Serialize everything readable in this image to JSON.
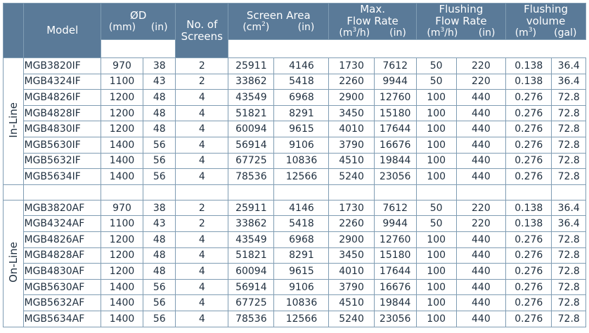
{
  "headers": {
    "model": "Model",
    "od": "ØD",
    "od_mm": "(mm)",
    "od_in": "(in)",
    "screens_1": "No. of",
    "screens_2": "Screens",
    "area": "Screen Area",
    "area_cm": "(cm",
    "area_cm_sup": "2",
    "area_cm_close": ")",
    "area_in": "(in)",
    "flow_1": "Max.",
    "flow_2": "Flow Rate",
    "flow_m": "(m",
    "flow_m_sup": "3",
    "flow_m_close": "/h)",
    "flow_in": "(in)",
    "flush_1": "Flushing",
    "flush_2": "Flow Rate",
    "flush_m": "(m",
    "flush_m_sup": "3",
    "flush_m_close": "/h)",
    "flush_in": "(in)",
    "vol_1": "Flushing",
    "vol_2": "volume",
    "vol_m": "(m",
    "vol_m_sup": "3",
    "vol_m_close": ")",
    "vol_gal": "(gal)"
  },
  "groups": [
    {
      "label": "In-Line",
      "rows": [
        [
          "MGB3820IF",
          "970",
          "38",
          "2",
          "25911",
          "4146",
          "1730",
          "7612",
          "50",
          "220",
          "0.138",
          "36.4"
        ],
        [
          "MGB4324IF",
          "1100",
          "43",
          "2",
          "33862",
          "5418",
          "2260",
          "9944",
          "50",
          "220",
          "0.138",
          "36.4"
        ],
        [
          "MGB4826IF",
          "1200",
          "48",
          "4",
          "43549",
          "6968",
          "2900",
          "12760",
          "100",
          "440",
          "0.276",
          "72.8"
        ],
        [
          "MGB4828IF",
          "1200",
          "48",
          "4",
          "51821",
          "8291",
          "3450",
          "15180",
          "100",
          "440",
          "0.276",
          "72.8"
        ],
        [
          "MGB4830IF",
          "1200",
          "48",
          "4",
          "60094",
          "9615",
          "4010",
          "17644",
          "100",
          "440",
          "0.276",
          "72.8"
        ],
        [
          "MGB5630IF",
          "1400",
          "56",
          "4",
          "56914",
          "9106",
          "3790",
          "16676",
          "100",
          "440",
          "0.276",
          "72.8"
        ],
        [
          "MGB5632IF",
          "1400",
          "56",
          "4",
          "67725",
          "10836",
          "4510",
          "19844",
          "100",
          "440",
          "0.276",
          "72.8"
        ],
        [
          "MGB5634IF",
          "1400",
          "56",
          "4",
          "78536",
          "12566",
          "5240",
          "23056",
          "100",
          "440",
          "0.276",
          "72.8"
        ]
      ]
    },
    {
      "label": "On-Line",
      "rows": [
        [
          "MGB3820AF",
          "970",
          "38",
          "2",
          "25911",
          "4146",
          "1730",
          "7612",
          "50",
          "220",
          "0.138",
          "36.4"
        ],
        [
          "MGB4324AF",
          "1100",
          "43",
          "2",
          "33862",
          "5418",
          "2260",
          "9944",
          "50",
          "220",
          "0.138",
          "36.4"
        ],
        [
          "MGB4826AF",
          "1200",
          "48",
          "4",
          "43549",
          "6968",
          "2900",
          "12760",
          "100",
          "440",
          "0.276",
          "72.8"
        ],
        [
          "MGB4828AF",
          "1200",
          "48",
          "4",
          "51821",
          "8291",
          "3450",
          "15180",
          "100",
          "440",
          "0.276",
          "72.8"
        ],
        [
          "MGB4830AF",
          "1200",
          "48",
          "4",
          "60094",
          "9615",
          "4010",
          "17644",
          "100",
          "440",
          "0.276",
          "72.8"
        ],
        [
          "MGB5630AF",
          "1400",
          "56",
          "4",
          "56914",
          "9106",
          "3790",
          "16676",
          "100",
          "440",
          "0.276",
          "72.8"
        ],
        [
          "MGB5632AF",
          "1400",
          "56",
          "4",
          "67725",
          "10836",
          "4510",
          "19844",
          "100",
          "440",
          "0.276",
          "72.8"
        ],
        [
          "MGB5634AF",
          "1400",
          "56",
          "4",
          "78536",
          "12566",
          "5240",
          "23056",
          "100",
          "440",
          "0.276",
          "72.8"
        ]
      ]
    }
  ],
  "colors": {
    "header_bg": "#5a7a98",
    "header_text": "#ffffff",
    "border": "#7f9cb3",
    "cell_text": "#1f2f3f"
  }
}
